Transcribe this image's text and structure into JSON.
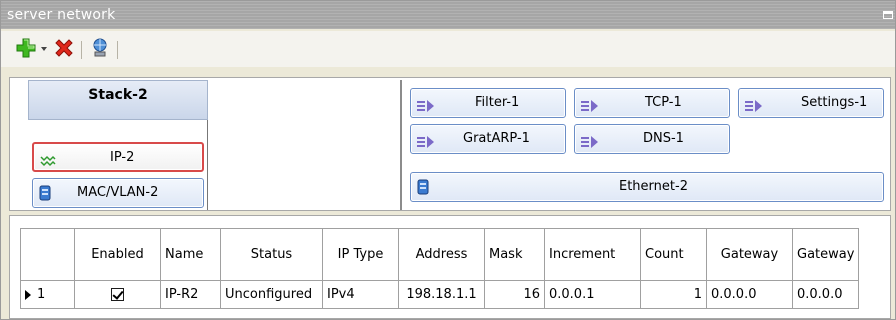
{
  "window": {
    "title": "server network"
  },
  "toolbar": {
    "icons": [
      "add-icon",
      "delete-icon",
      "network-wizard-icon"
    ]
  },
  "stack": {
    "header": "Stack-2",
    "left_blocks": [
      {
        "label": "IP-2",
        "icon": "ip-icon",
        "selected": true
      },
      {
        "label": "MAC/VLAN-2",
        "icon": "device-icon",
        "selected": false
      }
    ],
    "right_blocks_row1": [
      "Filter-1",
      "TCP-1",
      "Settings-1"
    ],
    "right_blocks_row2": [
      "GratARP-1",
      "DNS-1"
    ],
    "ethernet": "Ethernet-2"
  },
  "table": {
    "columns": [
      "",
      "Enabled",
      "Name",
      "Status",
      "IP Type",
      "Address",
      "Mask",
      "Increment",
      "Count",
      "Gateway",
      "Gateway"
    ],
    "rows": [
      {
        "index": "1",
        "enabled": true,
        "name": "IP-R2",
        "status": "Unconfigured",
        "ip_type": "IPv4",
        "address": "198.18.1.1",
        "mask": "16",
        "increment": "0.0.0.1",
        "count": "1",
        "gateway": "0.0.0.0",
        "gateway2": "0.0.0.0"
      }
    ]
  },
  "colors": {
    "block_border": "#6b8ec7",
    "selected_border": "#d84a4a",
    "header_bg": "#cad6ea"
  }
}
